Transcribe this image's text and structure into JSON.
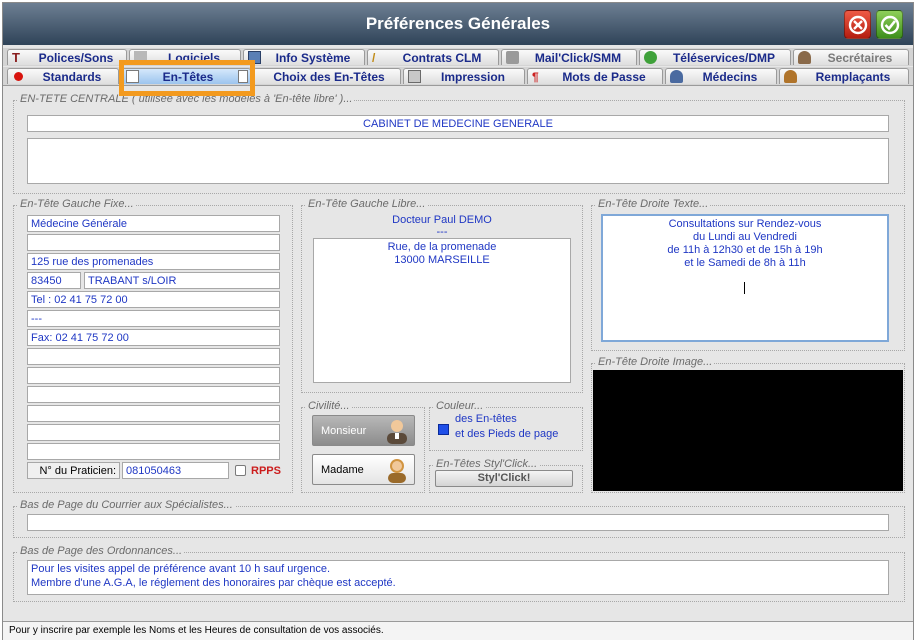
{
  "window": {
    "title": "Préférences Générales"
  },
  "titlebar_buttons": {
    "close_icon": "cancel-icon",
    "ok_icon": "ok-icon"
  },
  "tabs_row1": [
    {
      "label": "Polices/Sons",
      "icon": "text-icon"
    },
    {
      "label": "Logiciels",
      "icon": "software-icon"
    },
    {
      "label": "Info Système",
      "icon": "monitor-icon"
    },
    {
      "label": "Contrats CLM",
      "icon": "pencil-icon"
    },
    {
      "label": "Mail'Click/SMM",
      "icon": "mail-icon"
    },
    {
      "label": "Téléservices/DMP",
      "icon": "network-icon"
    },
    {
      "label": "Secrétaires",
      "icon": "user-icon"
    }
  ],
  "tabs_row2": [
    {
      "label": "Standards",
      "icon": "red-dot-icon"
    },
    {
      "label": "En-Têtes",
      "icon": "header-doc-icon"
    },
    {
      "label": "Choix des En-Têtes",
      "icon": "header-doc-icon"
    },
    {
      "label": "Impression",
      "icon": "printer-icon"
    },
    {
      "label": "Mots de Passe",
      "icon": "key-icon"
    },
    {
      "label": "Médecins",
      "icon": "doctor-icon"
    },
    {
      "label": "Remplaçants",
      "icon": "replacement-icon"
    }
  ],
  "entete_centrale": {
    "legend_visible": "EN-TETE CENTRALE",
    "legend_hidden": " ( utilisée avec les modèles à 'En-tête libre' )...",
    "line1": "CABINET DE MEDECINE GENERALE",
    "line2": ""
  },
  "gauche_fixe": {
    "legend": "En-Tête Gauche Fixe...",
    "lines": [
      "Médecine Générale",
      "",
      "125 rue des promenades"
    ],
    "postal_code": "83450",
    "city": "TRABANT s/LOIR",
    "lines2": [
      "Tel : 02 41 75 72 00",
      "",
      "---",
      "Fax: 02 41 75 72 00",
      "",
      "",
      "",
      "",
      "",
      ""
    ],
    "praticien_label": "N° du Praticien:",
    "praticien_value": "081050463",
    "rpps_label": "RPPS"
  },
  "gauche_libre": {
    "legend": "En-Tête Gauche Libre...",
    "name": "Docteur Paul DEMO",
    "sep": "---",
    "address": [
      "Rue, de la promenade",
      "13000 MARSEILLE"
    ]
  },
  "droite_texte": {
    "legend": "En-Tête Droite Texte...",
    "lines": [
      "Consultations sur Rendez-vous",
      "du Lundi  au Vendredi",
      "de 11h à 12h30 et de 15h à 19h",
      "et le Samedi de 8h à 11h"
    ]
  },
  "droite_image": {
    "legend": "En-Tête Droite Image..."
  },
  "civilite": {
    "legend": "Civilité...",
    "monsieur": "Monsieur",
    "madame": "Madame"
  },
  "couleur": {
    "legend": "Couleur...",
    "line1": "des En-têtes",
    "line2": "et des Pieds de page",
    "swatch": "#1f4fe8"
  },
  "stylclick": {
    "legend": "En-Têtes Styl'Click...",
    "button": "Styl'Click!"
  },
  "bas_specialistes": {
    "legend": "Bas de Page du Courrier  aux  Spécialistes...",
    "value": ""
  },
  "bas_ordonnances": {
    "legend": "Bas de Page des Ordonnances...",
    "lines": [
      "Pour les visites appel de préférence avant 10 h sauf urgence.",
      "Membre d'une A.G.A, le réglement des honoraires par chèque est accepté."
    ]
  },
  "status": {
    "text": "Pour y inscrire par exemple les Noms et les Heures de consultation de vos associés."
  },
  "colors": {
    "accent": "#f39a1e",
    "text_blue": "#1f37c4",
    "titlebar": "#3b4f66"
  }
}
